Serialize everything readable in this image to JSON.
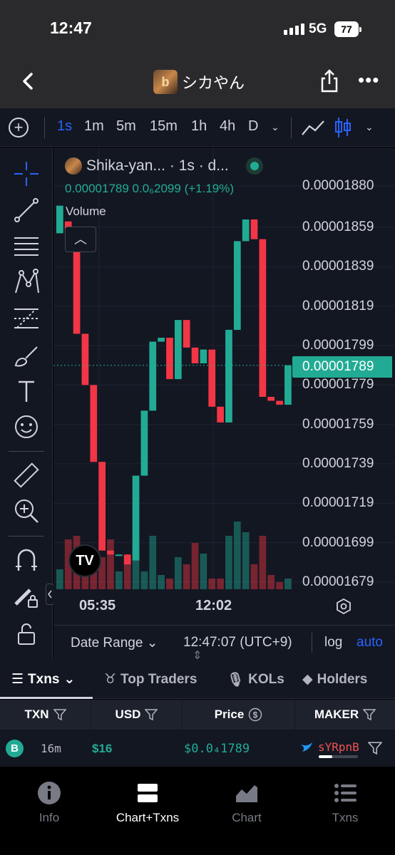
{
  "status": {
    "time": "12:47",
    "network": "5G",
    "battery": "77"
  },
  "header": {
    "token_name": "シカやん",
    "avatar_letter": "b"
  },
  "timeframes": {
    "items": [
      "1s",
      "1m",
      "5m",
      "15m",
      "1h",
      "4h",
      "D"
    ],
    "active": "1s"
  },
  "legend": {
    "symbol": "Shika-yan...",
    "interval": "· 1s · d...",
    "ohlc_text": "0.00001789  0.0₆2099 (+1.19%)",
    "volume_label": "Volume"
  },
  "colors": {
    "up": "#22ab94",
    "down": "#f23645",
    "accent": "#2962ff",
    "background": "#131722"
  },
  "chart_data": {
    "type": "candlestick",
    "y_ticks": [
      "0.00001880",
      "0.00001859",
      "0.00001839",
      "0.00001819",
      "0.00001799",
      "0.00001779",
      "0.00001759",
      "0.00001739",
      "0.00001719",
      "0.00001699",
      "0.00001679"
    ],
    "ylim": [
      1.67e-05,
      1.89e-05
    ],
    "current_price": "0.00001789",
    "x_ticks": [
      "05:35",
      "12:02"
    ],
    "candles": [
      {
        "o": 1.856e-05,
        "c": 1.87e-05,
        "h": 1.87e-05,
        "l": 1.856e-05
      },
      {
        "o": 1.862e-05,
        "c": 1.856e-05,
        "h": 1.862e-05,
        "l": 1.856e-05
      },
      {
        "o": 1.856e-05,
        "c": 1.805e-05,
        "h": 1.856e-05,
        "l": 1.805e-05
      },
      {
        "o": 1.805e-05,
        "c": 1.779e-05,
        "h": 1.805e-05,
        "l": 1.779e-05
      },
      {
        "o": 1.779e-05,
        "c": 1.74e-05,
        "h": 1.779e-05,
        "l": 1.74e-05
      },
      {
        "o": 1.74e-05,
        "c": 1.695e-05,
        "h": 1.74e-05,
        "l": 1.695e-05
      },
      {
        "o": 1.695e-05,
        "c": 1.693e-05,
        "h": 1.695e-05,
        "l": 1.693e-05
      },
      {
        "o": 1.693e-05,
        "c": 1.693e-05,
        "h": 1.693e-05,
        "l": 1.693e-05
      },
      {
        "o": 1.693e-05,
        "c": 1.688e-05,
        "h": 1.693e-05,
        "l": 1.688e-05
      },
      {
        "o": 1.69e-05,
        "c": 1.733e-05,
        "h": 1.733e-05,
        "l": 1.69e-05
      },
      {
        "o": 1.733e-05,
        "c": 1.766e-05,
        "h": 1.766e-05,
        "l": 1.733e-05
      },
      {
        "o": 1.766e-05,
        "c": 1.801e-05,
        "h": 1.801e-05,
        "l": 1.766e-05
      },
      {
        "o": 1.801e-05,
        "c": 1.803e-05,
        "h": 1.803e-05,
        "l": 1.801e-05
      },
      {
        "o": 1.803e-05,
        "c": 1.782e-05,
        "h": 1.803e-05,
        "l": 1.782e-05
      },
      {
        "o": 1.782e-05,
        "c": 1.812e-05,
        "h": 1.812e-05,
        "l": 1.782e-05
      },
      {
        "o": 1.812e-05,
        "c": 1.798e-05,
        "h": 1.812e-05,
        "l": 1.798e-05
      },
      {
        "o": 1.798e-05,
        "c": 1.79e-05,
        "h": 1.798e-05,
        "l": 1.79e-05
      },
      {
        "o": 1.79e-05,
        "c": 1.797e-05,
        "h": 1.797e-05,
        "l": 1.79e-05
      },
      {
        "o": 1.797e-05,
        "c": 1.768e-05,
        "h": 1.797e-05,
        "l": 1.768e-05
      },
      {
        "o": 1.768e-05,
        "c": 1.76e-05,
        "h": 1.768e-05,
        "l": 1.76e-05
      },
      {
        "o": 1.76e-05,
        "c": 1.807e-05,
        "h": 1.807e-05,
        "l": 1.76e-05
      },
      {
        "o": 1.807e-05,
        "c": 1.852e-05,
        "h": 1.852e-05,
        "l": 1.807e-05
      },
      {
        "o": 1.852e-05,
        "c": 1.863e-05,
        "h": 1.863e-05,
        "l": 1.852e-05
      },
      {
        "o": 1.863e-05,
        "c": 1.853e-05,
        "h": 1.863e-05,
        "l": 1.853e-05
      },
      {
        "o": 1.853e-05,
        "c": 1.773e-05,
        "h": 1.853e-05,
        "l": 1.773e-05
      },
      {
        "o": 1.773e-05,
        "c": 1.771e-05,
        "h": 1.773e-05,
        "l": 1.771e-05
      },
      {
        "o": 1.771e-05,
        "c": 1.769e-05,
        "h": 1.771e-05,
        "l": 1.769e-05
      },
      {
        "o": 1.769e-05,
        "c": 1.789e-05,
        "h": 1.789e-05,
        "l": 1.769e-05
      }
    ],
    "volumes": [
      0.28,
      0.7,
      0.75,
      0.6,
      0.5,
      0.45,
      0.7,
      0.25,
      0.4,
      0.6,
      0.25,
      0.75,
      0.2,
      0.15,
      0.45,
      0.35,
      0.65,
      0.5,
      0.15,
      0.15,
      0.75,
      0.95,
      0.8,
      0.35,
      0.75,
      0.2,
      0.1,
      0.15
    ]
  },
  "range_bar": {
    "date_range": "Date Range",
    "clock": "12:47:07 (UTC+9)",
    "log": "log",
    "auto": "auto"
  },
  "tabs": {
    "items": [
      "Txns",
      "Top Traders",
      "KOLs",
      "Holders"
    ],
    "active": "Txns"
  },
  "table": {
    "headers": [
      "TXN",
      "USD",
      "Price",
      "MAKER"
    ],
    "rows": [
      {
        "side": "B",
        "age": "16m",
        "usd": "$16",
        "price": "$0.0₄1789",
        "maker": "sYRpnB"
      }
    ]
  },
  "bottom_nav": {
    "items": [
      "Info",
      "Chart+Txns",
      "Chart",
      "Txns"
    ],
    "active": "Chart+Txns"
  }
}
